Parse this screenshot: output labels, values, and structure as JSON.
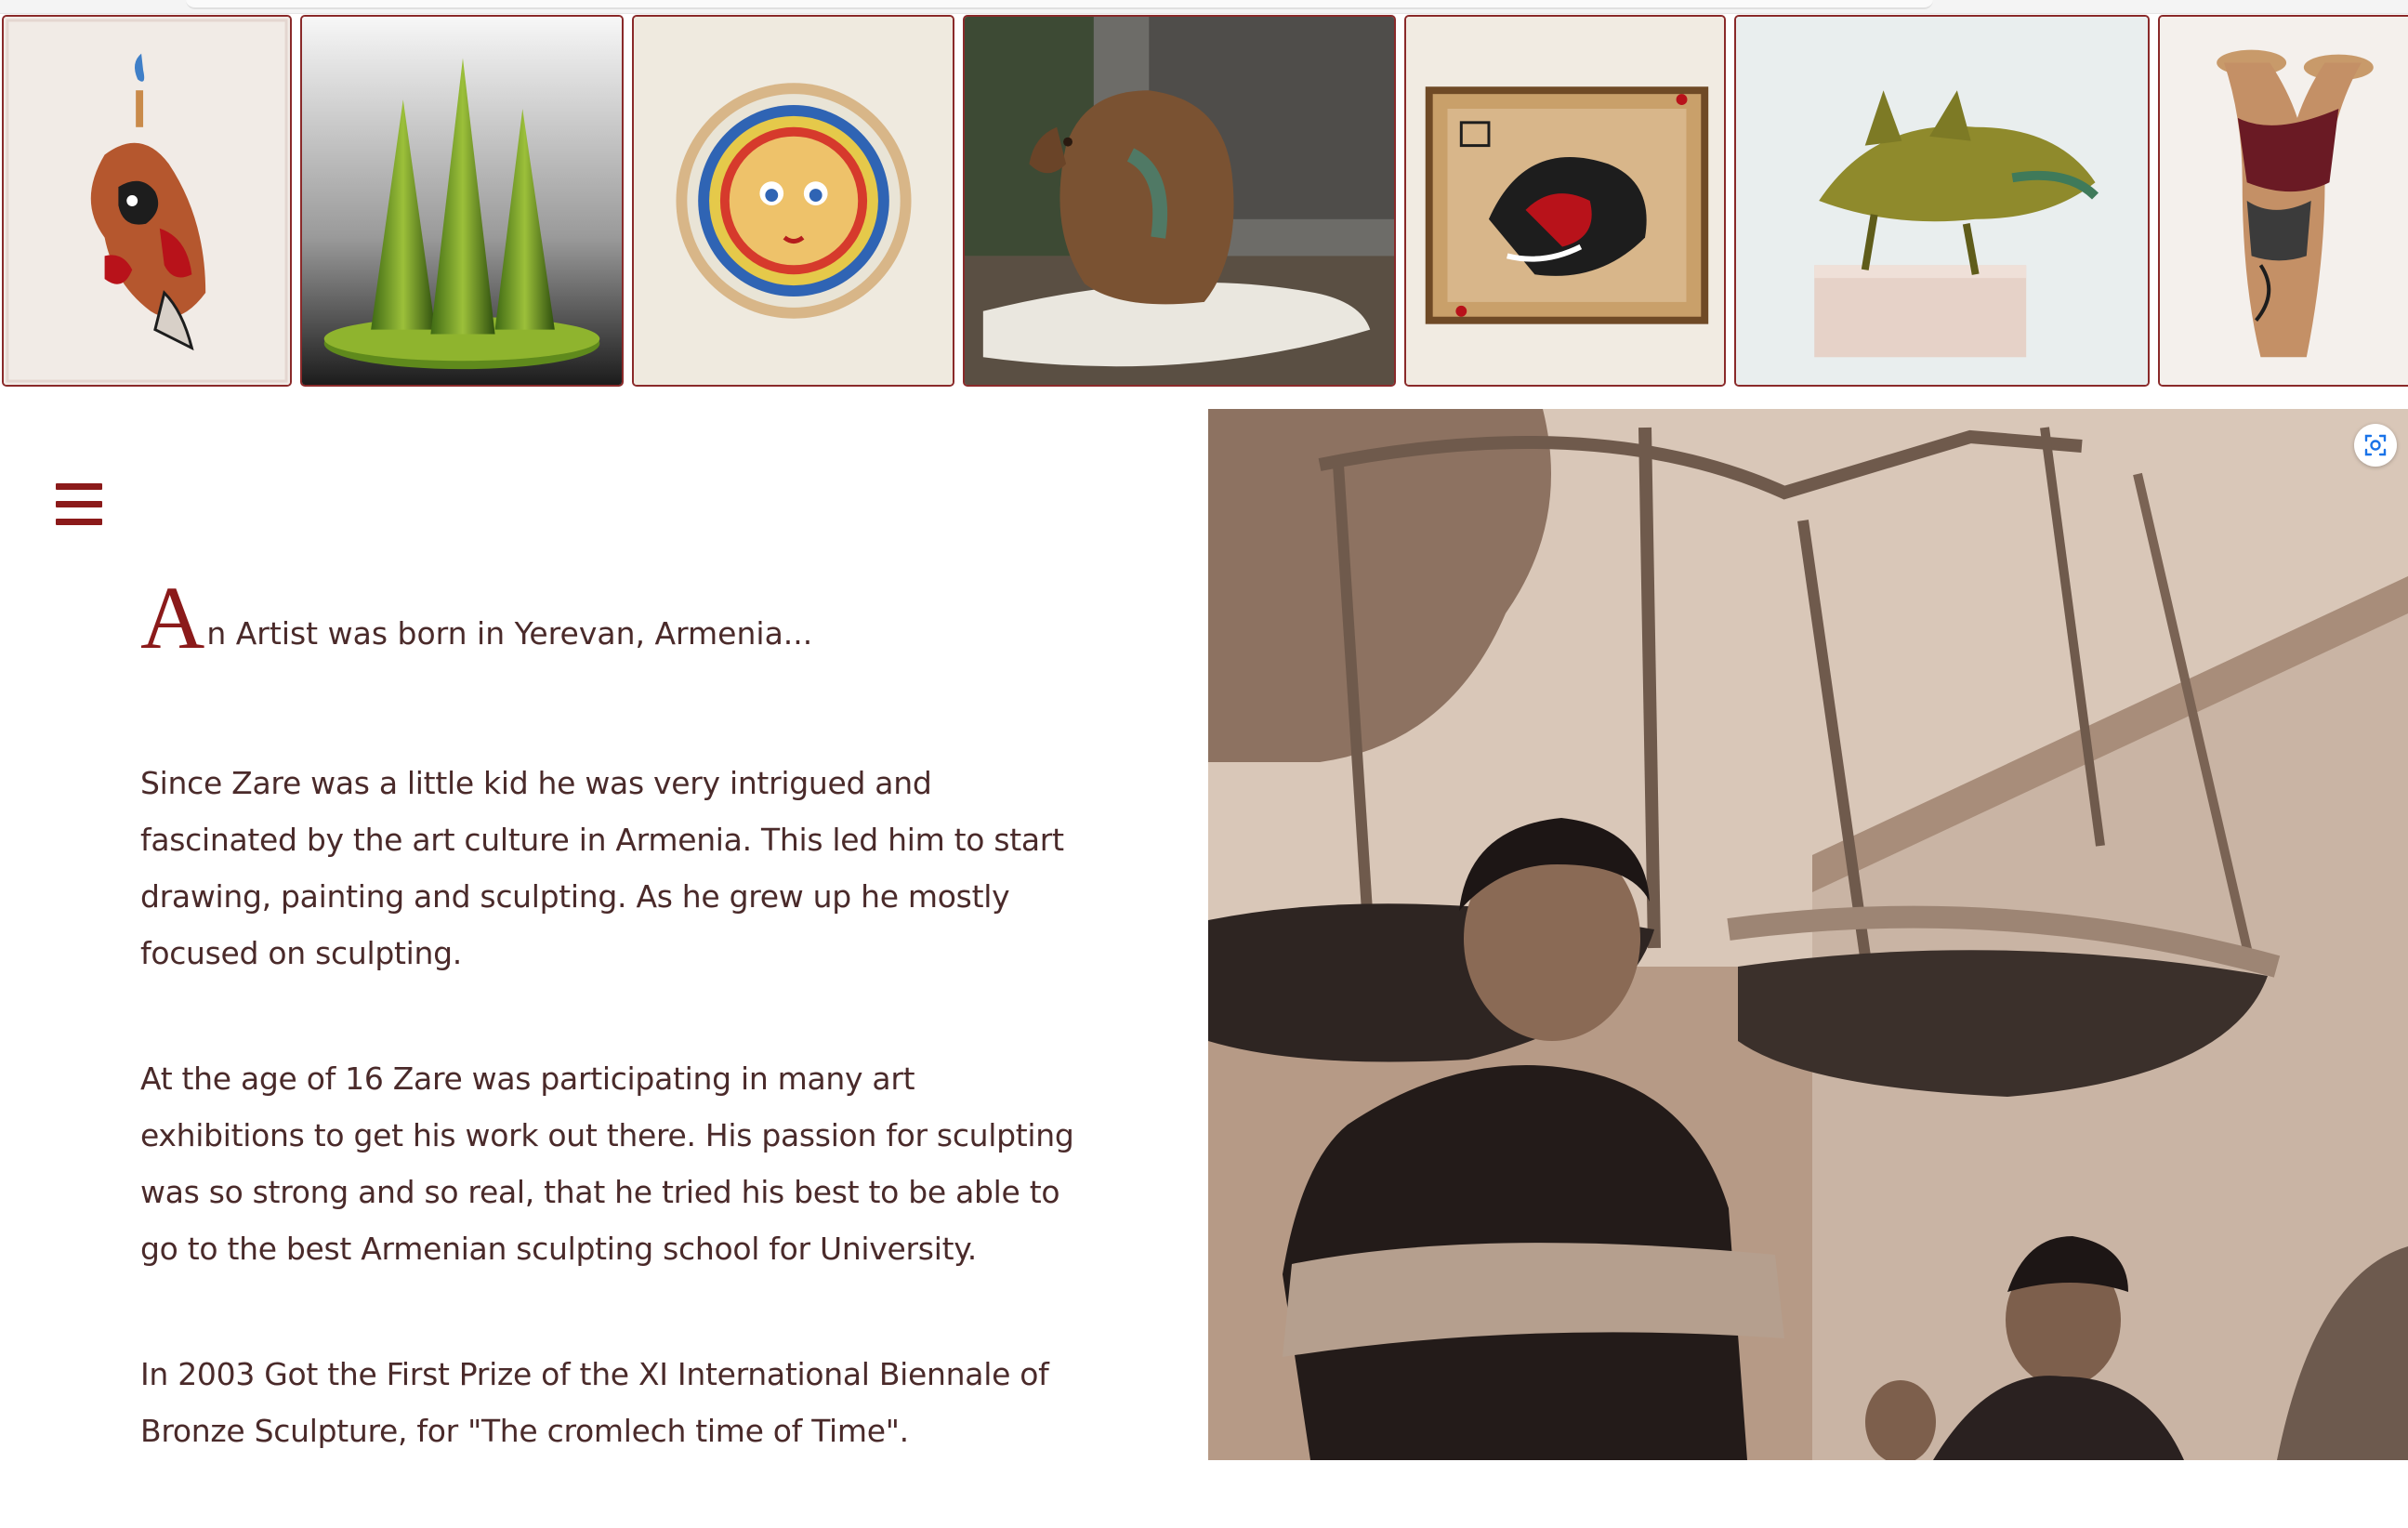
{
  "gallery": {
    "items": [
      {
        "subject": "fish-ornament-pendant"
      },
      {
        "subject": "green-cones-sculpture"
      },
      {
        "subject": "sun-face-plate"
      },
      {
        "subject": "bronze-pig-sculpture"
      },
      {
        "subject": "framed-bird-painting"
      },
      {
        "subject": "bronze-fish-sculpture"
      },
      {
        "subject": "ceramic-vase-sculpture"
      }
    ]
  },
  "menu": {
    "icon": "hamburger-menu-icon"
  },
  "article": {
    "dropcap": "A",
    "intro_rest": "n Artist was born in Yerevan, Armenia...",
    "paragraphs": [
      "Since Zare was a little kid he was very intrigued and fascinated by the art culture in Armenia. This led him to start drawing, painting and sculpting. As he grew up he mostly focused on sculpting.",
      "At the age of 16 Zare was participating in many art exhibitions to get his work out there. His passion for sculpting was so strong and so real, that he tried his best to be able to go to the best Armenian sculpting school for University.",
      "In 2003 Got the First Prize of the XI International Biennale of Bronze Sculpture, for \"The cromlech time of Time\"."
    ]
  },
  "photo": {
    "subject": "sepia-photo-of-young-sculptor"
  },
  "colors": {
    "accent": "#8b1a1a",
    "text": "#4a2a2a",
    "thumb_border": "#8a2a2a"
  }
}
